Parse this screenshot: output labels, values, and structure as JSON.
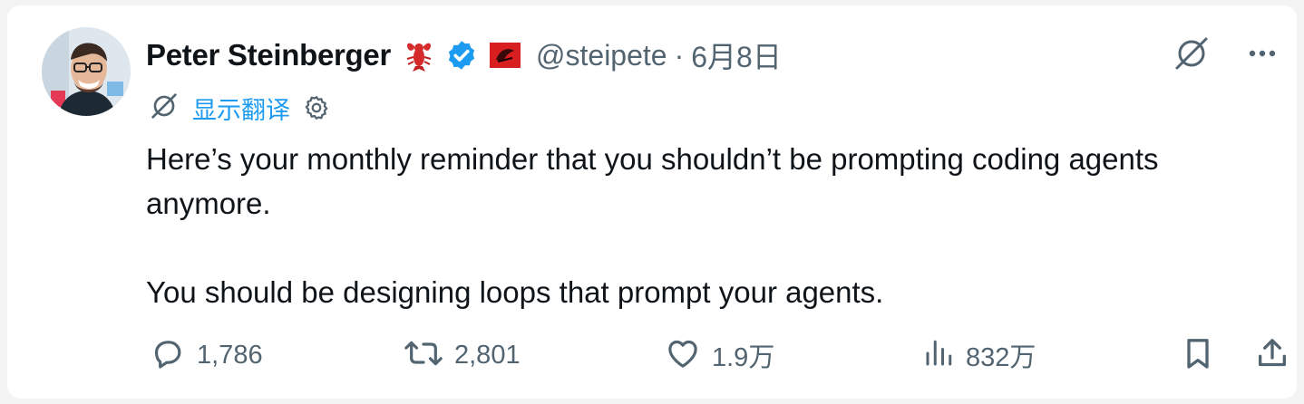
{
  "author": {
    "name": "Peter Steinberger",
    "handle": "@steipete",
    "separator": "·",
    "date": "6月8日"
  },
  "translate": {
    "label": "显示翻译"
  },
  "tweet": {
    "line1": "Here’s your monthly reminder that you shouldn’t be prompting coding agents anymore.",
    "line2": "You should be designing loops that prompt your agents."
  },
  "actions": {
    "replies": "1,786",
    "retweets": "2,801",
    "likes": "1.9万",
    "views": "832万"
  },
  "icons": {
    "emoji": "lobster-emoji",
    "verified": "verified-badge-icon",
    "flag": "red-flag-emoji",
    "grok": "grok-icon",
    "more": "more-icon",
    "reply": "reply-icon",
    "retweet": "retweet-icon",
    "like": "like-icon",
    "views": "views-icon",
    "bookmark": "bookmark-icon",
    "share": "share-icon",
    "settings": "gear-icon"
  },
  "colors": {
    "accent": "#1d9bf0",
    "text": "#0f1419",
    "secondary": "#536471",
    "background": "#ffffff"
  }
}
